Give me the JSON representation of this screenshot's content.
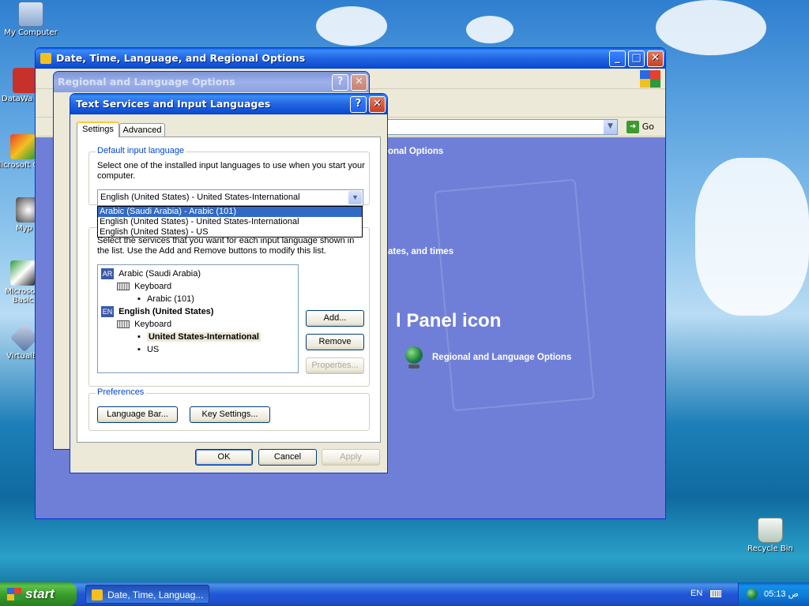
{
  "desktop": {
    "icons": [
      {
        "label": "My Computer",
        "icon": "computer-icon"
      },
      {
        "label": "DataWa",
        "icon": "shortcut-icon"
      },
      {
        "label": "Microsoft C++",
        "icon": "program-icon"
      },
      {
        "label": "Myp",
        "icon": "program-icon"
      },
      {
        "label": "Microsoft Basic",
        "icon": "program-icon"
      },
      {
        "label": "VirtualBo",
        "icon": "program-icon"
      },
      {
        "label": "Recycle Bin",
        "icon": "recycle-bin-icon"
      }
    ]
  },
  "control_panel": {
    "title": "Date, Time, Language, and Regional Options",
    "menu_partial": "Fi",
    "address_partial": "Ad",
    "go_label": "Go",
    "task_heading_partial": "onal Options",
    "pick_task_partial": "ates, and times",
    "panel_icon_heading_partial": "l Panel icon",
    "regional_link": "Regional and Language Options",
    "back_partial": "B"
  },
  "regional_dialog": {
    "title": "Regional and Language Options"
  },
  "text_services": {
    "title": "Text Services and Input Languages",
    "tabs": [
      "Settings",
      "Advanced"
    ],
    "default_group_label": "Default input language",
    "default_desc": "Select one of the installed input languages to use when you start your computer.",
    "selected_value": "English (United States) - United States-International",
    "dropdown_options": [
      "Arabic (Saudi Arabia) - Arabic (101)",
      "English (United States) - United States-International",
      "English (United States) - US"
    ],
    "services_desc": "Select the services that you want for each input language shown in the list. Use the Add and Remove buttons to modify this list.",
    "tree": [
      {
        "badge": "AR",
        "label": "Arabic (Saudi Arabia)",
        "bold": false,
        "kb": "Keyboard",
        "layouts": [
          {
            "label": "Arabic (101)",
            "bold": false
          }
        ]
      },
      {
        "badge": "EN",
        "label": "English (United States)",
        "bold": true,
        "kb": "Keyboard",
        "layouts": [
          {
            "label": "United States-International",
            "bold": true
          },
          {
            "label": "US",
            "bold": false
          }
        ]
      }
    ],
    "add_label": "Add...",
    "remove_label": "Remove",
    "properties_label": "Properties...",
    "preferences_label": "Preferences",
    "language_bar_label": "Language Bar...",
    "key_settings_label": "Key Settings...",
    "ok_label": "OK",
    "cancel_label": "Cancel",
    "apply_label": "Apply"
  },
  "taskbar": {
    "start_label": "start",
    "task_label": "Date, Time, Languag...",
    "lang_indicator": "EN",
    "clock": "05:13 ص"
  },
  "colors": {
    "xp_blue": "#0a5ee0",
    "selection": "#316ac5",
    "start_green": "#3c9a2e",
    "control_panel_bg": "#6f7fd8"
  }
}
